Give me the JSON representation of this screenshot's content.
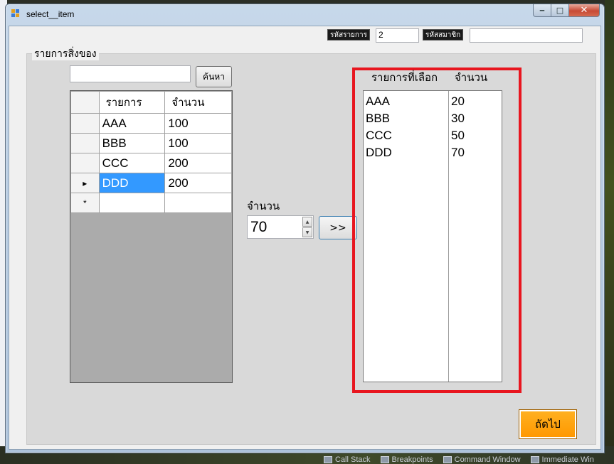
{
  "window": {
    "title": "select__item",
    "minimize": "‒",
    "maximize": "□",
    "close": "✕"
  },
  "topbar": {
    "item_code_label": "รหัสรายการ",
    "item_code_value": "2",
    "member_code_label": "รหัสสมาชิก",
    "member_code_value": ""
  },
  "groupbox": {
    "title": "รายการสิ่งของ"
  },
  "search": {
    "value": "",
    "button_label": "ค้นหา"
  },
  "grid": {
    "columns": [
      "รายการ",
      "จำนวน"
    ],
    "rows": [
      {
        "name": "AAA",
        "qty": "100"
      },
      {
        "name": "BBB",
        "qty": "100"
      },
      {
        "name": "CCC",
        "qty": "200"
      },
      {
        "name": "DDD",
        "qty": "200"
      }
    ],
    "current_row_marker": "▸",
    "new_row_marker": "*"
  },
  "quantity": {
    "label": "จำนวน",
    "value": "70",
    "add_button_label": ">>"
  },
  "selected": {
    "header_item": "รายการที่เลือก",
    "header_qty": "จำนวน",
    "items": [
      {
        "name": "AAA",
        "qty": "20"
      },
      {
        "name": "BBB",
        "qty": "30"
      },
      {
        "name": "CCC",
        "qty": "50"
      },
      {
        "name": "DDD",
        "qty": "70"
      }
    ]
  },
  "next_button_label": "ถัดไป",
  "taskbar": {
    "items": [
      "Call Stack",
      "Breakpoints",
      "Command Window",
      "Immediate Win"
    ]
  },
  "colors": {
    "highlight_frame": "#e8161f",
    "next_button": "#ff9800",
    "selection": "#3399ff"
  }
}
